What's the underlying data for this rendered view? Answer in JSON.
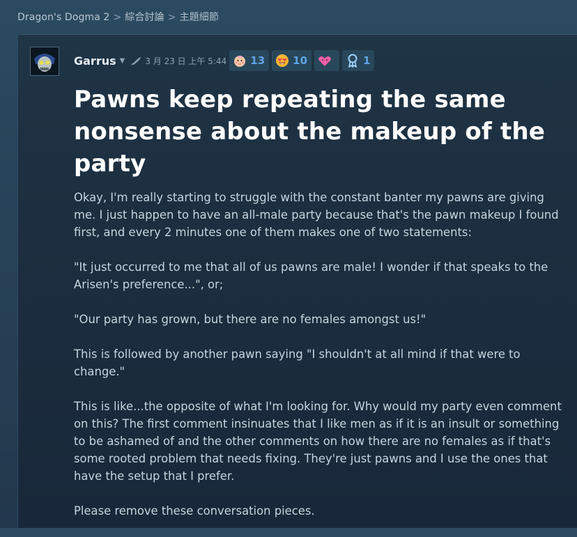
{
  "breadcrumb": {
    "items": [
      "Dragon's Dogma 2",
      "綜合討論",
      "主題細節"
    ],
    "separator": ">"
  },
  "post": {
    "author": "Garrus",
    "date": "3 月 23 日 上午 5:44",
    "awards": [
      {
        "icon": "baby-face-award-icon",
        "count": "13"
      },
      {
        "icon": "heart-eyes-award-icon",
        "count": "10"
      },
      {
        "icon": "pink-heart-award-icon",
        "count": ""
      },
      {
        "icon": "ribbon-medal-award-icon",
        "count": "1"
      }
    ],
    "title": "Pawns keep repeating the same nonsense about the makeup of the party",
    "paragraphs": [
      "Okay, I'm really starting to struggle with the constant banter my pawns are giving me. I just happen to have an all-male party because that's the pawn makeup I found first, and every 2 minutes one of them makes one of two statements:",
      "\"It just occurred to me that all of us pawns are male! I wonder if that speaks to the Arisen's preference...\", or;",
      "\"Our party has grown, but there are no females amongst us!\"",
      "This is followed by another pawn saying \"I shouldn't at all mind if that were to change.\"",
      "This is like...the opposite of what I'm looking for. Why would my party even comment on this? The first comment insinuates that I like men as if it is an insult or something to be ashamed of and the other comments on how there are no females as if that's some rooted problem that needs fixing. They're just pawns and I use the ones that have the setup that I prefer.",
      "Please remove these conversation pieces."
    ]
  },
  "colors": {
    "title": "#ffffff",
    "body_text": "#c6d4df",
    "award_count": "#5ea4e6",
    "panel_bg": "#1b2d3e"
  }
}
